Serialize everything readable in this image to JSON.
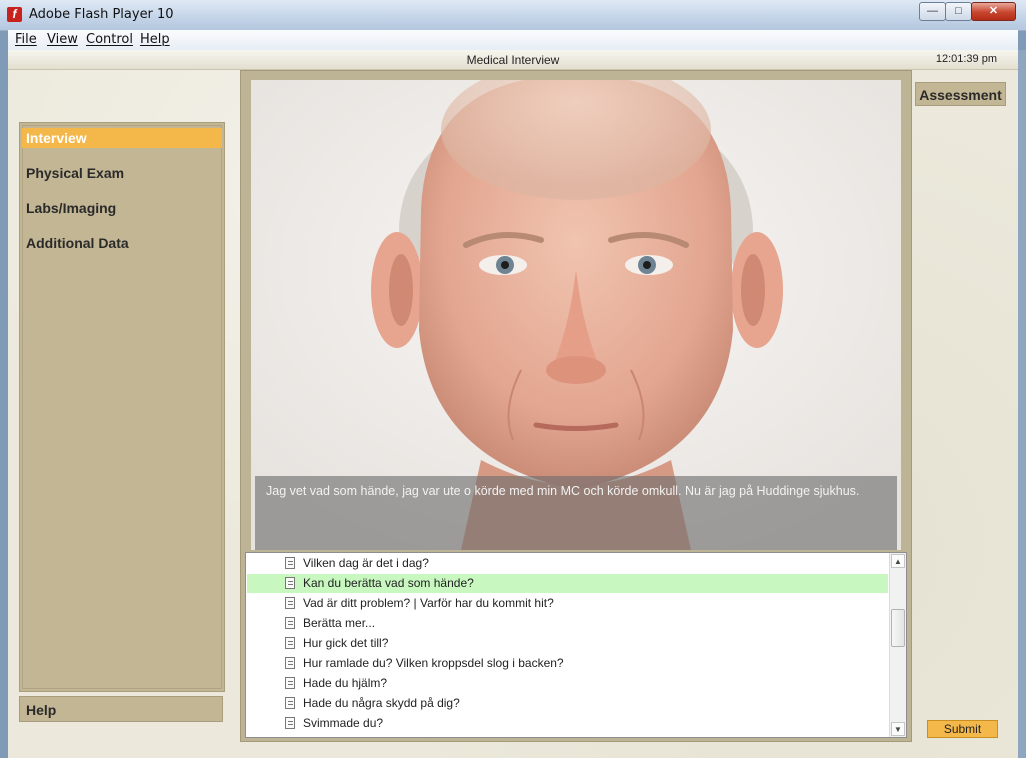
{
  "window": {
    "title": "Adobe Flash Player 10",
    "controls": {
      "minimize": "—",
      "maximize": "□",
      "close": "✕"
    }
  },
  "menu": [
    "File",
    "View",
    "Control",
    "Help"
  ],
  "header": {
    "title": "Medical Interview",
    "clock": "12:01:39 pm"
  },
  "sidebar": {
    "items": [
      {
        "label": "Interview",
        "active": true
      },
      {
        "label": "Physical Exam",
        "active": false
      },
      {
        "label": "Labs/Imaging",
        "active": false
      },
      {
        "label": "Additional Data",
        "active": false
      }
    ],
    "help": "Help"
  },
  "subtitle": "Jag vet vad som hände, jag var ute o körde med min MC och körde omkull. Nu är jag på Huddinge sjukhus.",
  "questions": [
    {
      "text": "Vilken dag är det i dag?",
      "highlight": false
    },
    {
      "text": "Kan du berätta vad som hände?",
      "highlight": true
    },
    {
      "text": "Vad är ditt problem? | Varför har du kommit hit?",
      "highlight": false
    },
    {
      "text": "Berätta mer...",
      "highlight": false
    },
    {
      "text": "Hur gick det till?",
      "highlight": false
    },
    {
      "text": "Hur ramlade du? Vilken kroppsdel slog i backen?",
      "highlight": false
    },
    {
      "text": "Hade du hjälm?",
      "highlight": false
    },
    {
      "text": "Hade du några skydd på dig?",
      "highlight": false
    },
    {
      "text": "Svimmade du?",
      "highlight": false
    }
  ],
  "right": {
    "assessment": "Assessment",
    "submit": "Submit"
  },
  "icons": {
    "app": "flash-player-icon",
    "question": "document-icon",
    "scroll_up": "▲",
    "scroll_down": "▼"
  },
  "colors": {
    "accent": "#f4b84a",
    "panel": "#c2b694",
    "highlight_row": "#c8f7c0",
    "background": "#ece9dc"
  }
}
